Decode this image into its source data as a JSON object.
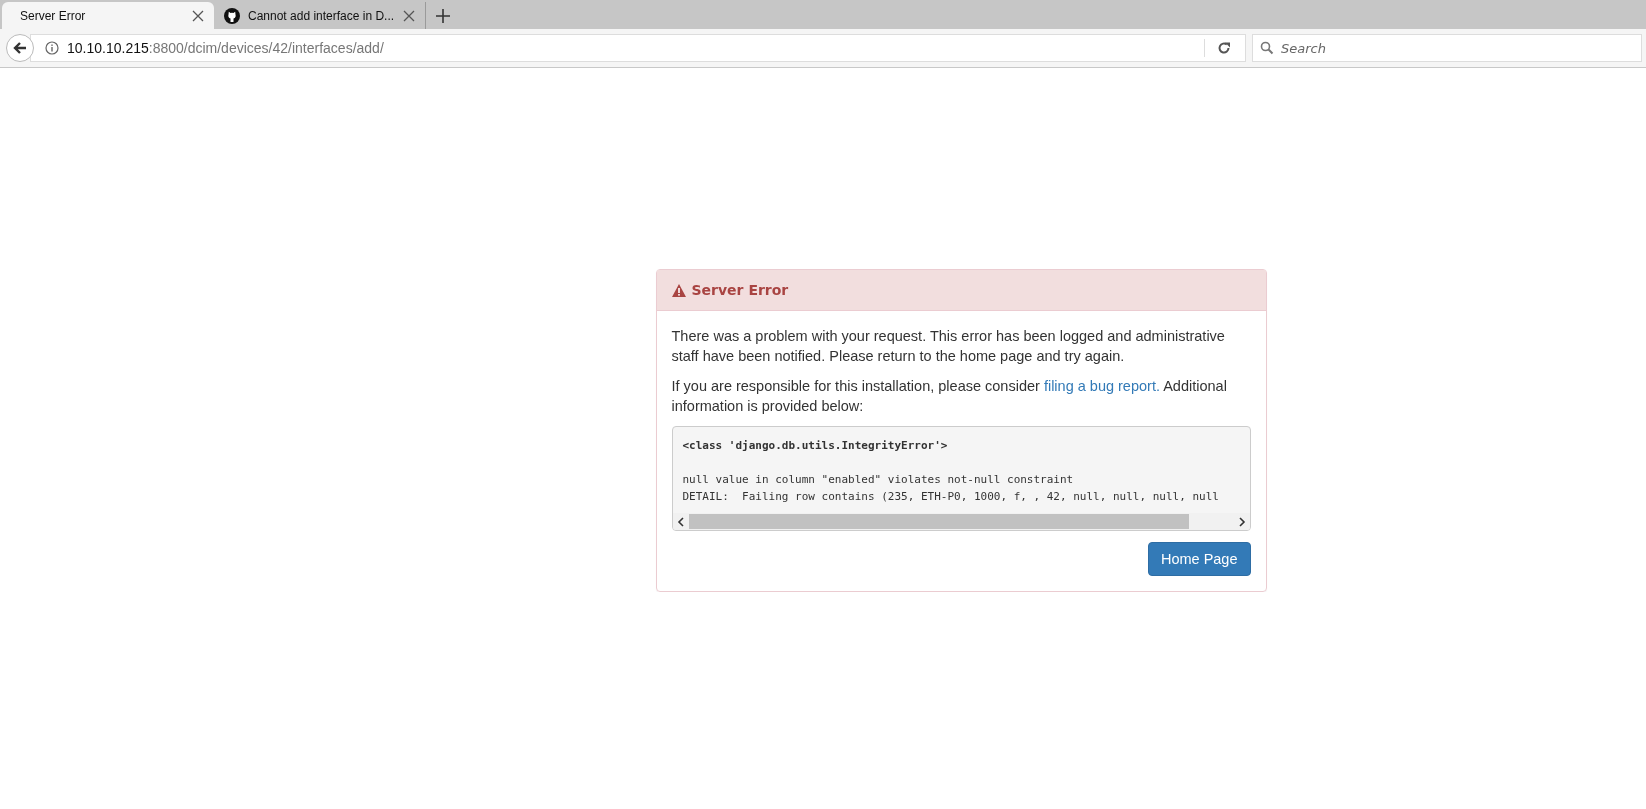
{
  "tabs": [
    {
      "title": "Server Error",
      "selected": true,
      "kind": "plain"
    },
    {
      "title": "Cannot add interface in D...",
      "selected": false,
      "kind": "favicon"
    }
  ],
  "address_bar": {
    "host": "10.10.10.215",
    "path": ":8800/dcim/devices/42/interfaces/add/"
  },
  "search": {
    "placeholder": "Search"
  },
  "error_panel": {
    "title": "Server Error",
    "message": "There was a problem with your request. This error has been logged and administrative staff have been notified. Please return to the home page and try again.",
    "help_before": "If you are responsible for this installation, please consider ",
    "help_link": "filing a bug report.",
    "help_after": " Additional information is provided below:",
    "traceback": [
      "<class 'django.db.utils.IntegrityError'>",
      "null value in column \"enabled\" violates not-null constraint",
      "DETAIL:  Failing row contains (235, ETH-P0, 1000, f, , 42, null, null, null, null"
    ],
    "button": "Home Page"
  }
}
